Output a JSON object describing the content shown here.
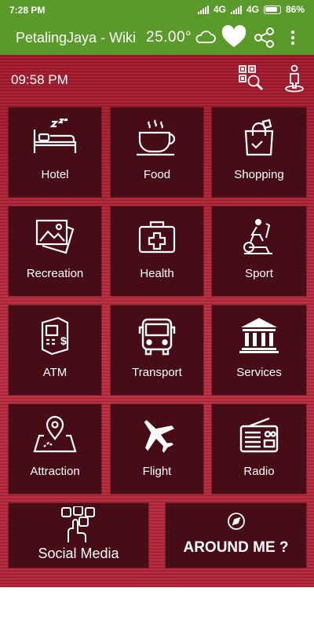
{
  "status_bar": {
    "time": "7:28 PM",
    "network_1": "4G",
    "network_2": "4G",
    "battery": "86%"
  },
  "app_bar": {
    "title": "PetalingJaya - Wiki",
    "temperature": "25.00°",
    "icons": [
      "cloud-icon",
      "heart-icon",
      "share-icon",
      "more-vert-icon"
    ]
  },
  "header": {
    "clock": "09:58 PM",
    "icons": [
      "qr-search-icon",
      "person-location-icon"
    ]
  },
  "tiles": [
    {
      "label": "Hotel",
      "icon": "bed-icon"
    },
    {
      "label": "Food",
      "icon": "coffee-cup-icon"
    },
    {
      "label": "Shopping",
      "icon": "shopping-bag-icon"
    },
    {
      "label": "Recreation",
      "icon": "picture-icon"
    },
    {
      "label": "Health",
      "icon": "medical-kit-icon"
    },
    {
      "label": "Sport",
      "icon": "exercise-bike-icon"
    },
    {
      "label": "ATM",
      "icon": "atm-icon"
    },
    {
      "label": "Transport",
      "icon": "bus-icon"
    },
    {
      "label": "Services",
      "icon": "bank-icon"
    },
    {
      "label": "Attraction",
      "icon": "map-pin-icon"
    },
    {
      "label": "Flight",
      "icon": "airplane-icon"
    },
    {
      "label": "Radio",
      "icon": "radio-icon"
    }
  ],
  "bottom_tiles": [
    {
      "label": "Social Media",
      "icon": "social-media-icon"
    },
    {
      "label": "AROUND ME ?",
      "icon": "compass-icon"
    }
  ],
  "colors": {
    "app_bar": "#5a9a2a",
    "background": "#b8283a",
    "tile": "#460d17",
    "text": "#ffffff"
  }
}
